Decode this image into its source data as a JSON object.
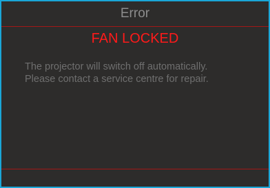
{
  "dialog": {
    "title": "Error",
    "headline": "FAN LOCKED",
    "message_line1": "The projector will switch off automatically.",
    "message_line2": "Please contact a service centre for repair."
  },
  "colors": {
    "frame_border": "#1aa7d8",
    "background": "#2d2c2b",
    "divider": "#a31717",
    "headline": "#ff1a1a",
    "title_text": "#8d8d8d",
    "message_text": "#6f6f6f"
  }
}
